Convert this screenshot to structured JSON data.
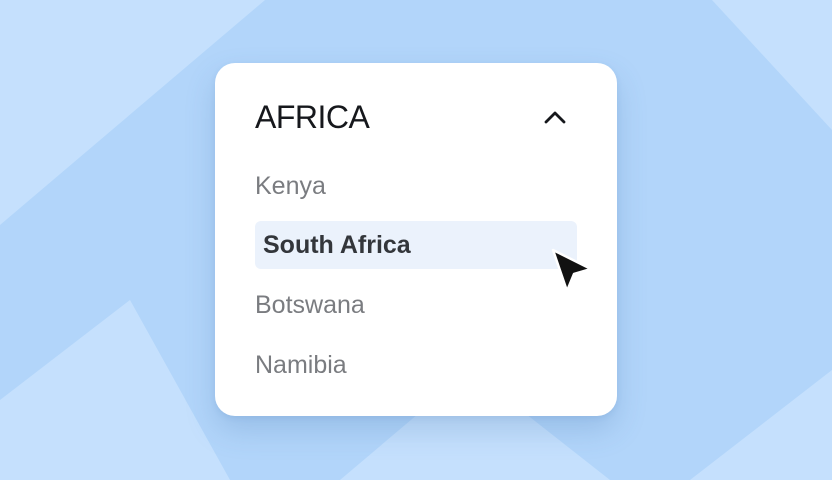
{
  "colors": {
    "background": "#b2d5fa",
    "background_light": "#c5e0fd",
    "card": "#ffffff",
    "selected_row": "#ebf2fc",
    "title_text": "#16181c",
    "option_text": "#7a7c80",
    "selected_text": "#33363b"
  },
  "dropdown": {
    "title": "AFRICA",
    "expanded": true,
    "toggle_icon": "chevron-up-icon",
    "options": [
      {
        "label": "Kenya",
        "selected": false
      },
      {
        "label": "South Africa",
        "selected": true
      },
      {
        "label": "Botswana",
        "selected": false
      },
      {
        "label": "Namibia",
        "selected": false
      }
    ]
  },
  "pointer": {
    "icon": "arrow-cursor-icon"
  }
}
